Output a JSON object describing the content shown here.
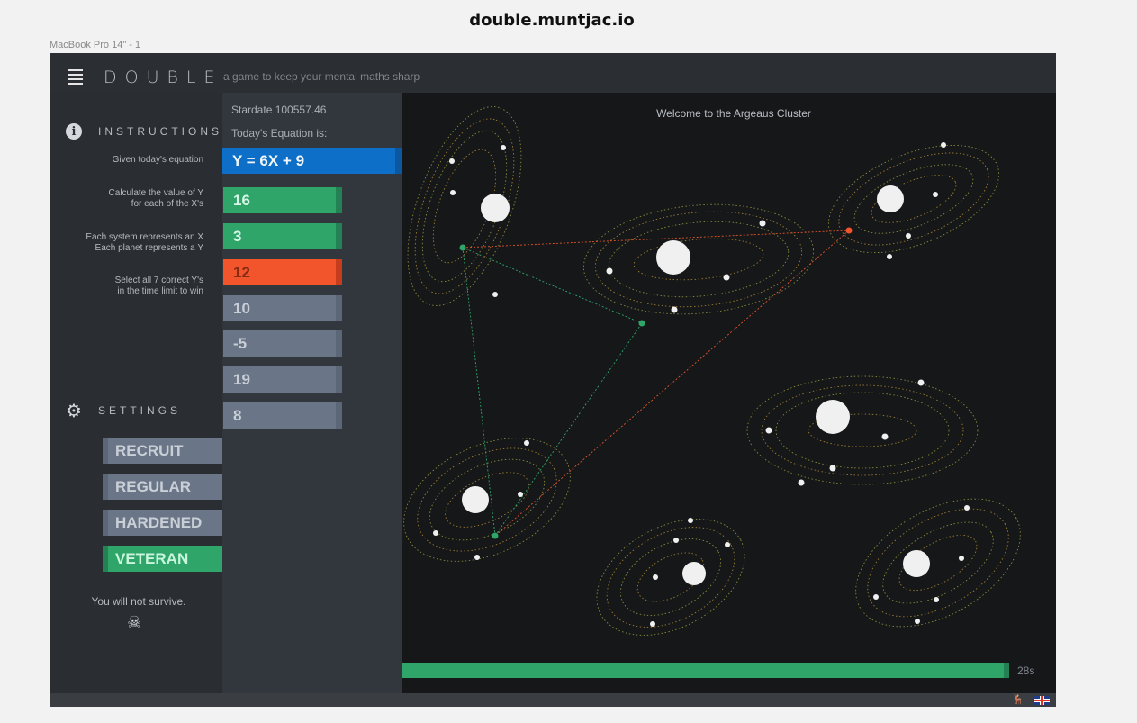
{
  "page": {
    "site_title": "double.muntjac.io",
    "frame_label": "MacBook Pro 14\" - 1"
  },
  "header": {
    "brand": "DOUBLE",
    "tagline": "a game to keep your mental maths sharp",
    "menu_icon": "hamburger-menu-icon"
  },
  "sidebar": {
    "instructions_title": "INSTRUCTIONS",
    "instructions_icon": "info-icon",
    "instructions": [
      {
        "line1": "Given today's equation",
        "line2": ""
      },
      {
        "line1": "Calculate the value of Y",
        "line2": "for each of the X's"
      },
      {
        "line1": "Each system represents an X",
        "line2": "Each planet represents a Y"
      },
      {
        "line1": "Select all 7 correct Y's",
        "line2": "in the time limit to win"
      }
    ],
    "settings_title": "SETTINGS",
    "settings_icon": "gear-icon",
    "difficulties": [
      {
        "label": "RECRUIT",
        "active": false
      },
      {
        "label": "REGULAR",
        "active": false
      },
      {
        "label": "HARDENED",
        "active": false
      },
      {
        "label": "VETERAN",
        "active": true
      }
    ],
    "warning": "You will not survive.",
    "warning_icon": "skull-crossbones-icon"
  },
  "panel": {
    "stardate": "Stardate 100557.46",
    "equation_label": "Today's Equation is:",
    "equation": "Y = 6X + 9",
    "answers": [
      {
        "value": "16",
        "status": "correct"
      },
      {
        "value": "3",
        "status": "correct"
      },
      {
        "value": "12",
        "status": "wrong"
      },
      {
        "value": "10",
        "status": "pending"
      },
      {
        "value": "-5",
        "status": "pending"
      },
      {
        "value": "19",
        "status": "pending"
      },
      {
        "value": "8",
        "status": "pending"
      }
    ]
  },
  "game": {
    "welcome": "Welcome to the Argeaus Cluster",
    "timer_text": "28s",
    "colors": {
      "correct": "#2fa56a",
      "wrong": "#f2552c",
      "equation": "#0e6fc8",
      "orbit": "#8a8a3a"
    }
  },
  "footer": {
    "language_icon": "uk-flag-icon",
    "critter_icon": "muntjac-icon"
  }
}
